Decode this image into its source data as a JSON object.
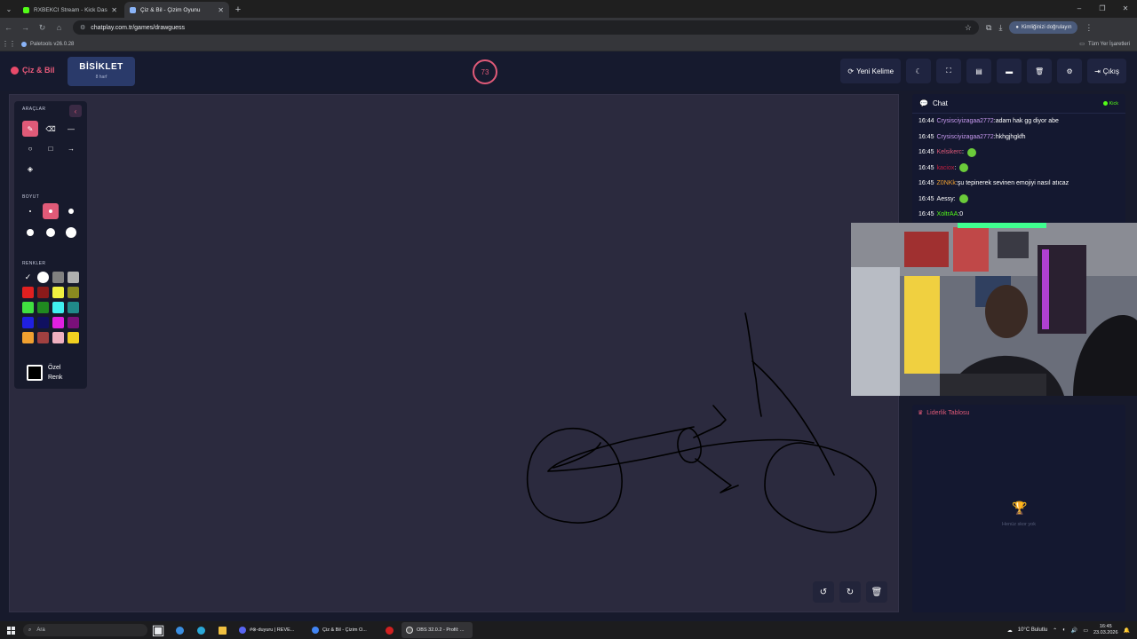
{
  "browser": {
    "tabs": [
      {
        "title": "RXBEKCI Stream - Kick Dashbo",
        "favicon_color": "#53fc18",
        "active": false
      },
      {
        "title": "Çiz & Bil - Çizim Oyunu",
        "favicon_color": "#8ab4f8",
        "active": true
      }
    ],
    "url": "chatplay.com.tr/games/drawguess",
    "profile_label": "Kimliğinizi doğrulayın",
    "bookmark": "Paletools v26.0.28",
    "bookmarks_all": "Tüm Yer İşaretleri"
  },
  "app": {
    "logo": "Çiz & Bil",
    "word": "BİSİKLET",
    "word_hint": "8 harf",
    "timer": "73",
    "actions": {
      "new_word": "Yeni Kelime",
      "logout": "Çıkış"
    }
  },
  "tools": {
    "tools_title": "ARAÇLAR",
    "size_title": "BOYUT",
    "colors_title": "RENKLER",
    "custom_color": "Özel Renk",
    "colors": [
      "#000000",
      "#ffffff",
      "#808080",
      "#b0b0b0",
      "#e02020",
      "#8b1a1a",
      "#f0f040",
      "#8a8a20",
      "#40e040",
      "#208a20",
      "#40f0f0",
      "#208a8a",
      "#2020e0",
      "#101060",
      "#e020e0",
      "#7a107a",
      "#f0a030",
      "#a04040",
      "#f0b0c0",
      "#f0d020"
    ]
  },
  "chat": {
    "title": "Chat",
    "platform": "Kick",
    "messages": [
      {
        "time": "16:44",
        "user": "Crysisciyizagaa2772",
        "user_color": "#c89af0",
        "text": "adam hak gg diyor abe",
        "emote": false
      },
      {
        "time": "16:45",
        "user": "Crysisciyizagaa2772",
        "user_color": "#c89af0",
        "text": "hkhgjhgkfh",
        "emote": false
      },
      {
        "time": "16:45",
        "user": "Kelsikerc",
        "user_color": "#e05a78",
        "text": "",
        "emote": true
      },
      {
        "time": "16:45",
        "user": "kaciox",
        "user_color": "#c02040",
        "text": "",
        "emote": true
      },
      {
        "time": "16:45",
        "user": "Z0NKk",
        "user_color": "#f0a030",
        "text": "şu tepinerek sevinen emojiyi nasıl atıcaz",
        "emote": false
      },
      {
        "time": "16:45",
        "user": "Aessy",
        "user_color": "#ffffff",
        "text": "",
        "emote": true
      },
      {
        "time": "16:45",
        "user": "XoltrAA",
        "user_color": "#53fc18",
        "text": "0",
        "emote": false
      }
    ]
  },
  "leaderboard": {
    "title": "Liderlik Tablosu",
    "empty": "Henüz skor yok"
  },
  "taskbar": {
    "search": "Ara",
    "apps": [
      {
        "label": "#⊗-duyuru | REVE...",
        "color": "#5865f2"
      },
      {
        "label": "Çiz & Bil - Çizim O...",
        "color": "#4285f4"
      },
      {
        "label": "OBS 32.0.2 - Profil: ...",
        "color": "#3a3a3a"
      }
    ],
    "weather": "10°C  Bulutlu",
    "time": "16:45",
    "date": "23.03.2026"
  }
}
